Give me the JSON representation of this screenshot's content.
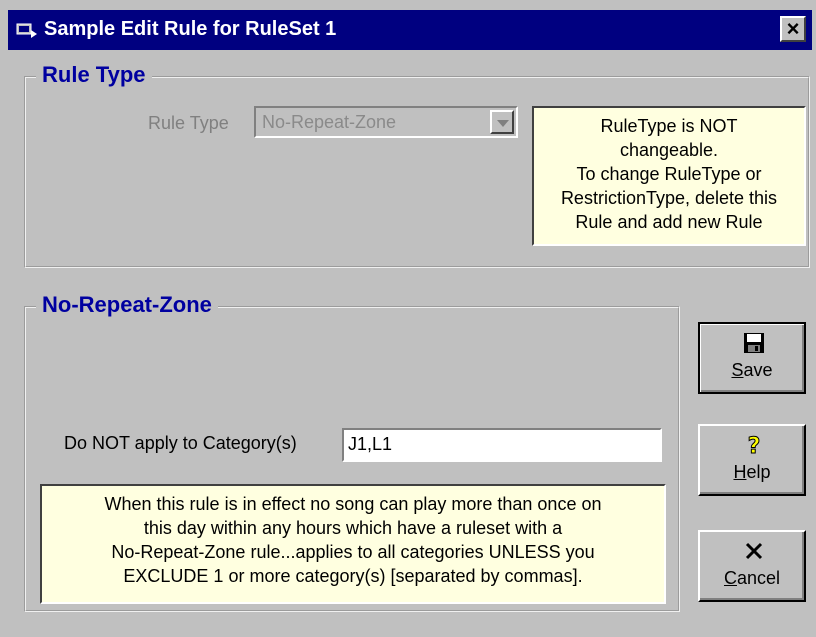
{
  "window": {
    "title": "Sample Edit Rule for RuleSet 1",
    "close_label": "×"
  },
  "rule_type_group": {
    "legend": "Rule Type",
    "field_label": "Rule Type",
    "combo_value": "No-Repeat-Zone",
    "note_lines": [
      "RuleType is NOT",
      "changeable.",
      "To change RuleType or",
      "RestrictionType, delete this",
      "Rule and add new Rule"
    ]
  },
  "zone_group": {
    "legend": "No-Repeat-Zone",
    "category_label": "Do NOT apply to Category(s)",
    "category_value": "J1,L1",
    "note_lines": [
      "When this rule is in effect no song can play more than once on",
      "this day within any hours which have a ruleset with a",
      "No-Repeat-Zone rule...applies to all categories UNLESS you",
      "EXCLUDE 1 or more category(s) [separated by commas]."
    ]
  },
  "buttons": {
    "save": {
      "mnemonic": "S",
      "rest": "ave",
      "icon": "floppy-disk-icon"
    },
    "help": {
      "mnemonic": "H",
      "rest": "elp",
      "icon": "question-mark-icon"
    },
    "cancel": {
      "mnemonic": "C",
      "rest": "ancel",
      "icon": "x-mark-icon"
    }
  },
  "colors": {
    "titlebar": "#000080",
    "legend": "#0000a0",
    "note_bg": "#ffffe0",
    "face": "#c0c0c0"
  }
}
